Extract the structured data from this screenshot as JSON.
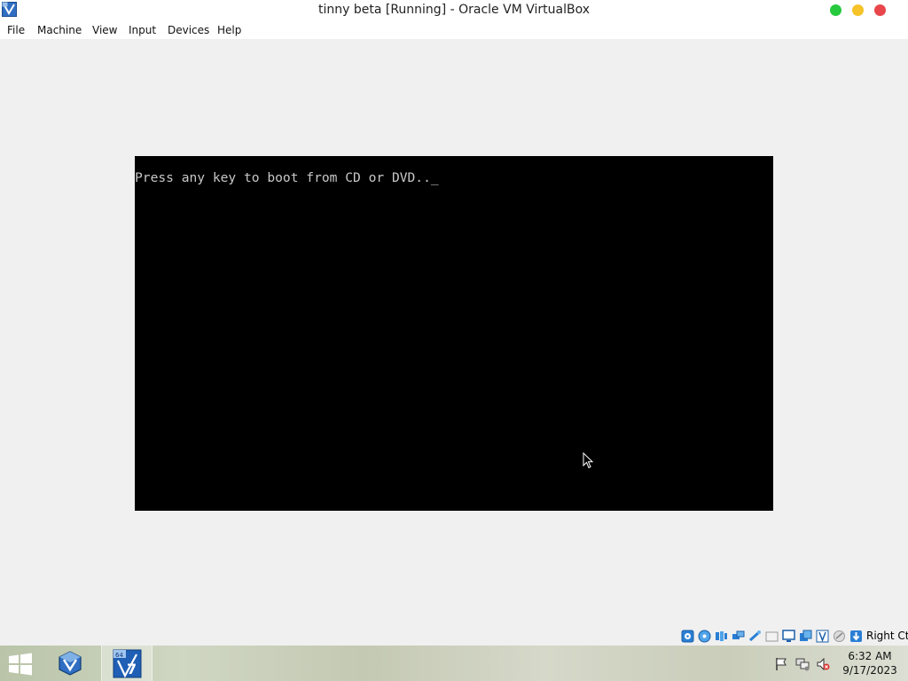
{
  "window": {
    "title": "tinny beta [Running] - Oracle VM VirtualBox",
    "icon": "virtualbox-icon",
    "controls": [
      "maximize-button",
      "minimize-button",
      "close-button"
    ]
  },
  "menu": [
    "File",
    "Machine",
    "View",
    "Input",
    "Devices",
    "Help"
  ],
  "vm_screen": {
    "text": "Press any key to boot from CD or DVD.._"
  },
  "statusbar": {
    "icons": [
      "hard-disk-icon",
      "optical-drive-icon",
      "audio-icon",
      "network-icon",
      "usb-icon",
      "shared-folders-icon",
      "display-icon",
      "video-capture-icon",
      "vt-x-icon",
      "mouse-integration-icon",
      "keyboard-capture-icon"
    ],
    "host_key": "Right Ctrl"
  },
  "taskbar": {
    "start": "windows-start-icon",
    "apps": [
      "virtualbox-manager-icon",
      "windows-7-x64-vm-icon"
    ],
    "tray": [
      "action-center-flag-icon",
      "network-icon",
      "volume-muted-icon"
    ],
    "time": "6:32 AM",
    "date": "9/17/2023"
  },
  "colors": {
    "window_bg": "#f0f0f0",
    "vm_bg": "#000000",
    "vm_text": "#c8c8c8",
    "close": "#e8464b",
    "minimize": "#f6c328",
    "maximize": "#27c93f"
  }
}
